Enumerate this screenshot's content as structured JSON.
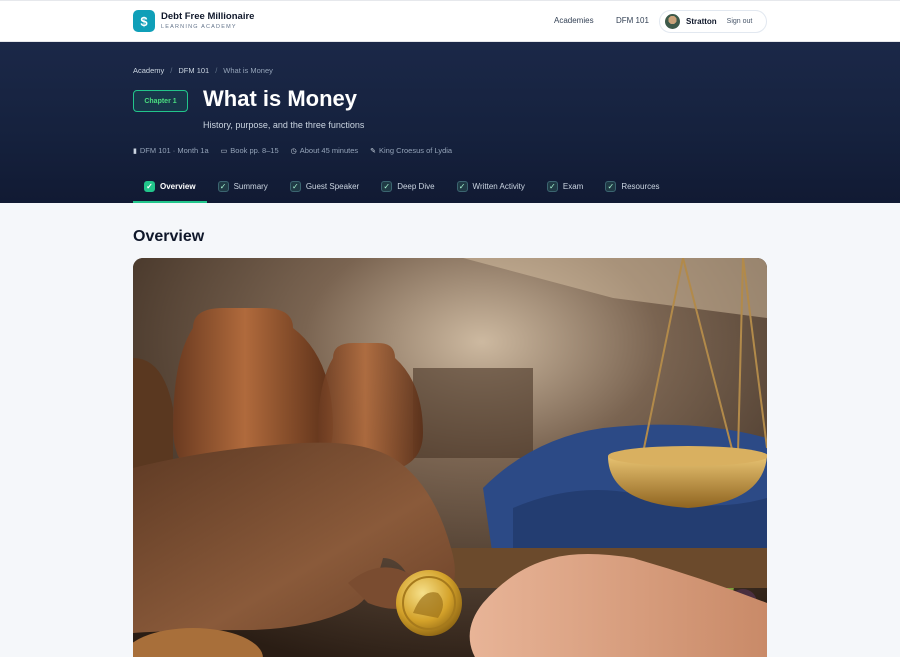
{
  "brand": {
    "logo_glyph": "$",
    "name": "Debt Free Millionaire",
    "subtitle": "LEARNING ACADEMY"
  },
  "nav": {
    "links": [
      "Academies",
      "DFM 101"
    ],
    "user_name": "Stratton",
    "signout_label": "Sign out"
  },
  "breadcrumb": {
    "items": [
      "Academy",
      "DFM 101",
      "What is Money"
    ]
  },
  "lesson": {
    "chapter_badge": "Chapter 1",
    "title": "What is Money",
    "subtitle": "History, purpose, and the three functions",
    "meta": [
      {
        "icon": "book-stack-icon",
        "text": "DFM 101 · Month 1a"
      },
      {
        "icon": "book-icon",
        "text": "Book pp. 8–15"
      },
      {
        "icon": "clock-icon",
        "text": "About 45 minutes"
      },
      {
        "icon": "pen-icon",
        "text": "King Croesus of Lydia"
      }
    ]
  },
  "tabs": [
    {
      "label": "Overview",
      "active": true,
      "completed": true
    },
    {
      "label": "Summary",
      "active": false,
      "completed": true
    },
    {
      "label": "Guest Speaker",
      "active": false,
      "completed": true
    },
    {
      "label": "Deep Dive",
      "active": false,
      "completed": true
    },
    {
      "label": "Written Activity",
      "active": false,
      "completed": true
    },
    {
      "label": "Exam",
      "active": false,
      "completed": true
    },
    {
      "label": "Resources",
      "active": false,
      "completed": true
    }
  ],
  "content": {
    "section_title": "Overview"
  },
  "colors": {
    "accent": "#22c58b",
    "hero_bg": "#15213d",
    "brand_logo": "#0f9fb8"
  }
}
